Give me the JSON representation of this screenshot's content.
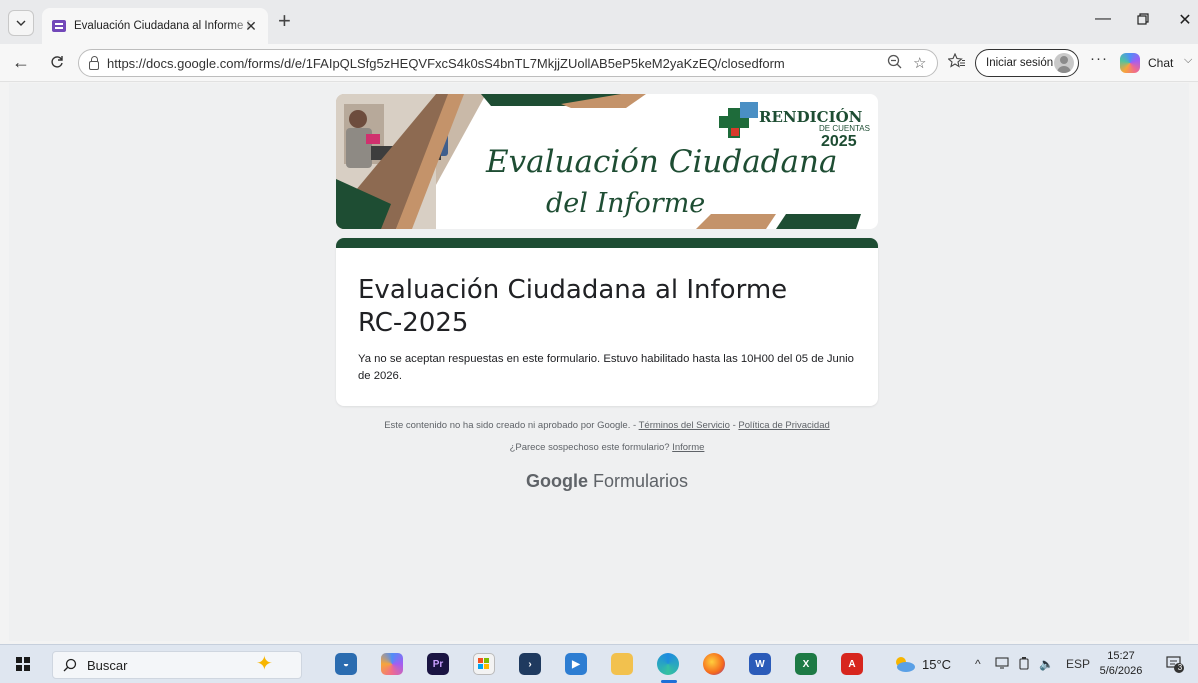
{
  "browser": {
    "tab_title": "Evaluación Ciudadana al Informe RC",
    "url": "https://docs.google.com/forms/d/e/1FAIpQLSfg5zHEQVFxcS4k0sS4bnTL7MkjjZUollAB5eP5keM2yaKzEQ/closedform",
    "signin_label": "Iniciar sesión",
    "chat_label": "Chat",
    "more_label": "···"
  },
  "banner": {
    "script_line1": "Evaluación Ciudadana",
    "script_line2": "del Informe",
    "brand_name": "RENDICIÓN",
    "brand_sub": "DE CUENTAS",
    "brand_year": "2025",
    "accent_green": "#1e4d33",
    "accent_tan": "#c4936a"
  },
  "form": {
    "title": "Evaluación Ciudadana al Informe RC-2025",
    "message": "Ya no se aceptan respuestas en este formulario. Estuvo habilitado hasta las 10H00 del 05 de Junio de 2026."
  },
  "footer": {
    "disclaimer": "Este contenido no ha sido creado ni aprobado por Google. - ",
    "terms_link": "Términos del Servicio",
    "separator": " - ",
    "privacy_link": "Política de Privacidad",
    "suspicious_text": "¿Parece sospechoso este formulario? ",
    "report_link": "Informe",
    "brand_google": "Google",
    "brand_product": "Formularios"
  },
  "taskbar": {
    "search_label": "Buscar",
    "temperature": "15°C",
    "language": "ESP",
    "time": "15:27",
    "date": "5/6/2026",
    "notification_count": "3"
  }
}
